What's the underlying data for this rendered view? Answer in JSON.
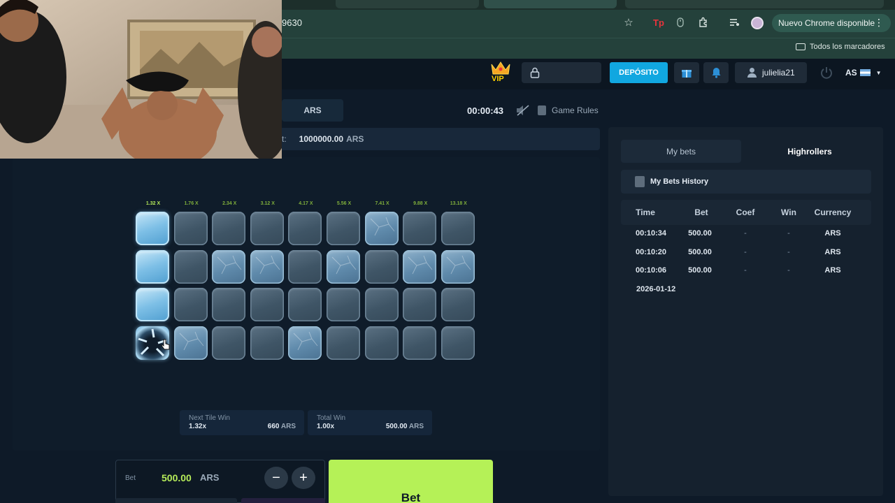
{
  "browser": {
    "url_fragment": "9630",
    "update_label": "Nuevo Chrome disponible",
    "bookmarks_all": "Todos los marcadores"
  },
  "header": {
    "vip": "VIP",
    "deposit": "DEPÓSITO",
    "username": "julielia21",
    "lang": "AS"
  },
  "game": {
    "currency": "ARS",
    "timer": "00:00:43",
    "rules": "Game Rules",
    "maxbet_prefix": "t:",
    "maxbet_value": "1000000.00",
    "maxbet_currency": "ARS",
    "multipliers": [
      "1.32 X",
      "1.76 X",
      "2.34 X",
      "3.12 X",
      "4.17 X",
      "5.56 X",
      "7.41 X",
      "9.88 X",
      "13.18 X"
    ],
    "next_tile": {
      "label": "Next Tile Win",
      "mult": "1.32x",
      "value": "660",
      "currency": "ARS"
    },
    "total_win": {
      "label": "Total Win",
      "mult": "1.00x",
      "value": "500.00",
      "currency": "ARS"
    },
    "bet": {
      "label": "Bet",
      "amount": "500.00",
      "currency": "ARS",
      "minus": "−",
      "plus": "+",
      "button": "Bet"
    }
  },
  "side": {
    "tab_my_bets": "My bets",
    "tab_highrollers": "Highrollers",
    "history_title": "My Bets History",
    "columns": [
      "Time",
      "Bet",
      "Coef",
      "Win",
      "Currency"
    ],
    "rows": [
      {
        "time": "00:10:34",
        "bet": "500.00",
        "coef": "-",
        "win": "-",
        "currency": "ARS"
      },
      {
        "time": "00:10:20",
        "bet": "500.00",
        "coef": "-",
        "win": "-",
        "currency": "ARS"
      },
      {
        "time": "00:10:06",
        "bet": "500.00",
        "coef": "-",
        "win": "-",
        "currency": "ARS"
      }
    ],
    "date": "2026-01-12"
  }
}
